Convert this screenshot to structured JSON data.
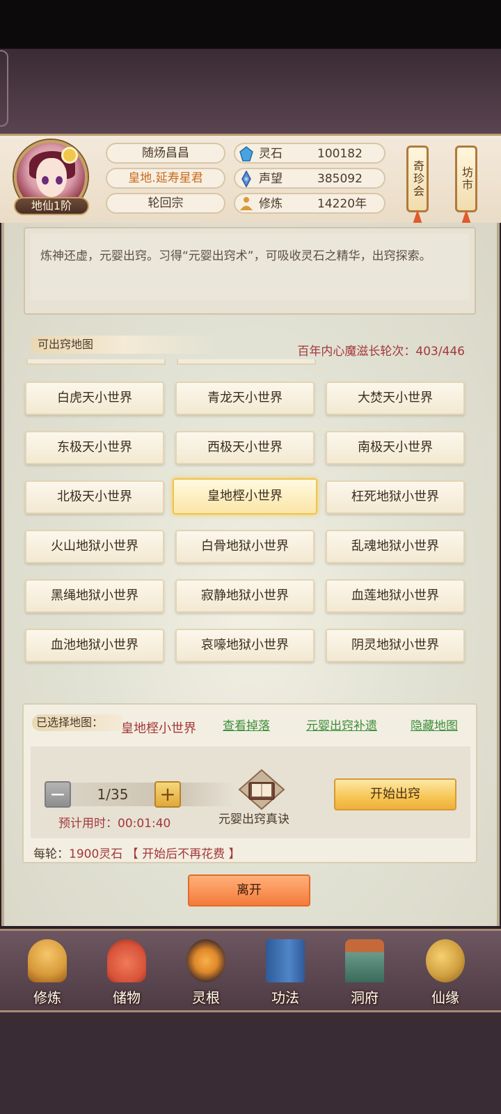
{
  "player": {
    "name": "随炀昌昌",
    "title": "皇地.延寿星君",
    "sect": "轮回宗",
    "rank": "地仙1阶"
  },
  "stats": [
    {
      "label": "灵石",
      "value": "100182",
      "icon": "spirit-stone-icon",
      "color": "#4aa3e0"
    },
    {
      "label": "声望",
      "value": "385092",
      "icon": "reputation-icon",
      "color": "#5a8fd6"
    },
    {
      "label": "修炼",
      "value": "14220年",
      "icon": "meditation-icon",
      "color": "#d99a3a"
    }
  ],
  "side_buttons": [
    {
      "label": "奇珍会"
    },
    {
      "label": "坊市"
    }
  ],
  "description": "炼神还虚，元婴出窍。习得“元婴出窍术”，可吸收灵石之精华，出窍探索。",
  "maps_section": {
    "label": "可出窍地图",
    "counter_label": "百年内心魔滋长轮次：",
    "counter_value": "403/446"
  },
  "maps": [
    {
      "name": "白虎天小世界",
      "selected": false
    },
    {
      "name": "青龙天小世界",
      "selected": false
    },
    {
      "name": "大焚天小世界",
      "selected": false
    },
    {
      "name": "东极天小世界",
      "selected": false
    },
    {
      "name": "西极天小世界",
      "selected": false
    },
    {
      "name": "南极天小世界",
      "selected": false
    },
    {
      "name": "北极天小世界",
      "selected": false
    },
    {
      "name": "皇地㭴小世界",
      "selected": true
    },
    {
      "name": "枉死地狱小世界",
      "selected": false
    },
    {
      "name": "火山地狱小世界",
      "selected": false
    },
    {
      "name": "白骨地狱小世界",
      "selected": false
    },
    {
      "name": "乱魂地狱小世界",
      "selected": false
    },
    {
      "name": "黑绳地狱小世界",
      "selected": false
    },
    {
      "name": "寂静地狱小世界",
      "selected": false
    },
    {
      "name": "血莲地狱小世界",
      "selected": false
    },
    {
      "name": "血池地狱小世界",
      "selected": false
    },
    {
      "name": "哀嚎地狱小世界",
      "selected": false
    },
    {
      "name": "阴灵地狱小世界",
      "selected": false
    }
  ],
  "selection": {
    "label": "已选择地图：",
    "map": "皇地㭴小世界",
    "links": [
      "查看掉落",
      "元婴出窍补遗",
      "隐藏地图"
    ],
    "minus": "−",
    "plus": "+",
    "quantity": "1/35",
    "eta_label": "预计用时：",
    "eta_value": "00:01:40",
    "item_label": "元婴出窍真诀",
    "start_button": "开始出窍",
    "cost_label": "每轮：",
    "cost_value": "1900灵石",
    "cost_note": "【 开始后不再花费 】"
  },
  "leave_button": "离开",
  "nav": [
    {
      "label": "修炼",
      "icon": "cultivation-icon",
      "color": "#d89a3a"
    },
    {
      "label": "储物",
      "icon": "storage-bag-icon",
      "color": "#d9543a"
    },
    {
      "label": "灵根",
      "icon": "spirit-root-icon",
      "color": "#e0892a"
    },
    {
      "label": "功法",
      "icon": "skill-book-icon",
      "color": "#3f6fb0"
    },
    {
      "label": "洞府",
      "icon": "cave-dwelling-icon",
      "color": "#7a9a6a"
    },
    {
      "label": "仙缘",
      "icon": "gourd-icon",
      "color": "#d0a040"
    }
  ]
}
